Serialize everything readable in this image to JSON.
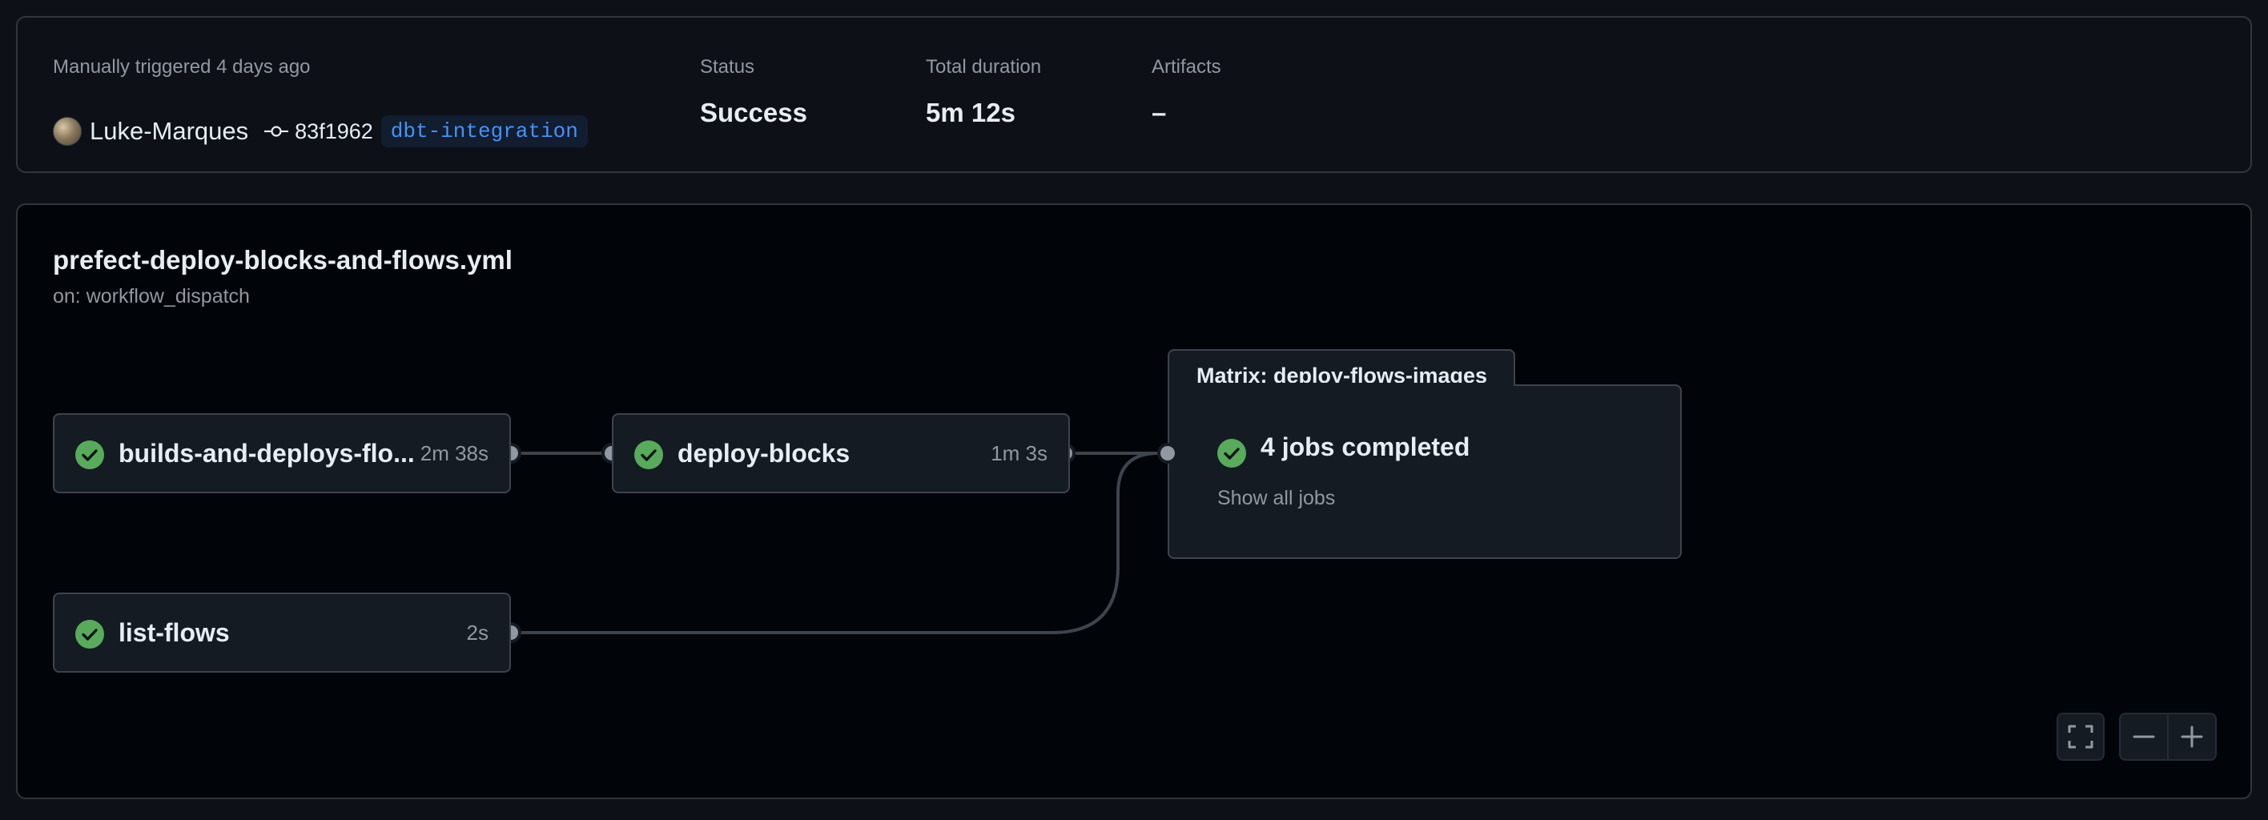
{
  "summary": {
    "trigger_text": "Manually triggered 4 days ago",
    "actor": "Luke-Marques",
    "commit_sha": "83f1962",
    "branch": "dbt-integration",
    "status_label": "Status",
    "status_value": "Success",
    "duration_label": "Total duration",
    "duration_value": "5m 12s",
    "artifacts_label": "Artifacts",
    "artifacts_value": "–"
  },
  "workflow": {
    "file_name": "prefect-deploy-blocks-and-flows.yml",
    "trigger": "on: workflow_dispatch"
  },
  "jobs": [
    {
      "name": "builds-and-deploys-flo...",
      "duration": "2m 38s",
      "status": "success"
    },
    {
      "name": "deploy-blocks",
      "duration": "1m 3s",
      "status": "success"
    },
    {
      "name": "list-flows",
      "duration": "2s",
      "status": "success"
    }
  ],
  "matrix": {
    "title": "Matrix: deploy-flows-images",
    "summary": "4 jobs completed",
    "link": "Show all jobs",
    "status": "success"
  },
  "controls": {
    "fullscreen": "fullscreen-icon",
    "zoom_out": "minus-icon",
    "zoom_in": "plus-icon"
  },
  "colors": {
    "success": "#57ab5a",
    "link": "#4493f8",
    "background": "#0d1117",
    "canvas": "#010409"
  }
}
